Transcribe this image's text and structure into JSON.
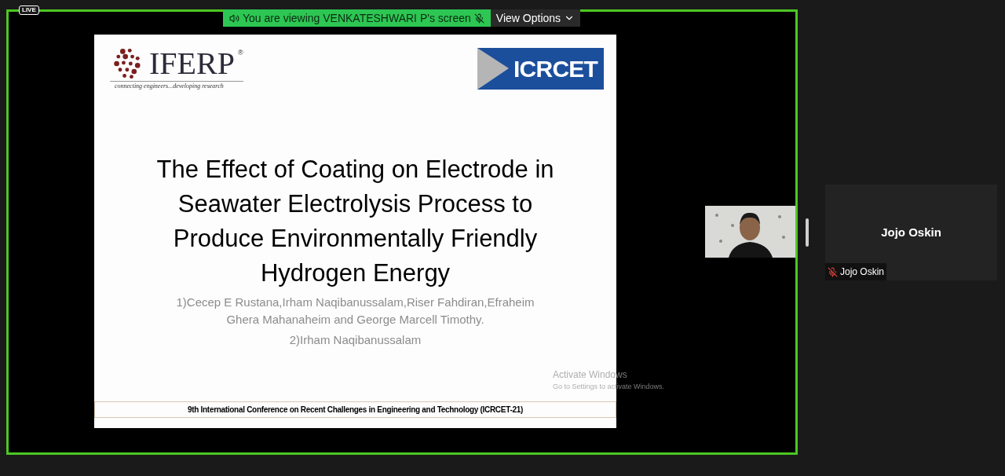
{
  "live_badge": "LIVE",
  "share_banner": {
    "text": "You are viewing VENKATESHWARI P's screen",
    "view_options": "View Options"
  },
  "slide": {
    "logo_left": {
      "name": "IFERP",
      "mark": "®",
      "tagline": "connecting engineers...developing research"
    },
    "logo_right": "ICRCET",
    "title": "The Effect of Coating on Electrode in Seawater Electrolysis Process to Produce Environmentally Friendly Hydrogen Energy",
    "authors": [
      "1)Cecep E Rustana,Irham Naqibanussalam,Riser Fahdiran,Efraheim Ghera Mahanaheim and George Marcell Timothy.",
      "2)Irham Naqibanussalam"
    ],
    "footer": "9th International Conference on Recent Challenges in Engineering and Technology (ICRCET-21)"
  },
  "os_notice": {
    "title": "Activate Windows",
    "subtitle": "Go to Settings to activate Windows."
  },
  "participant": {
    "name": "Jojo Oskin",
    "label": "Jojo Oskin",
    "muted": true
  }
}
